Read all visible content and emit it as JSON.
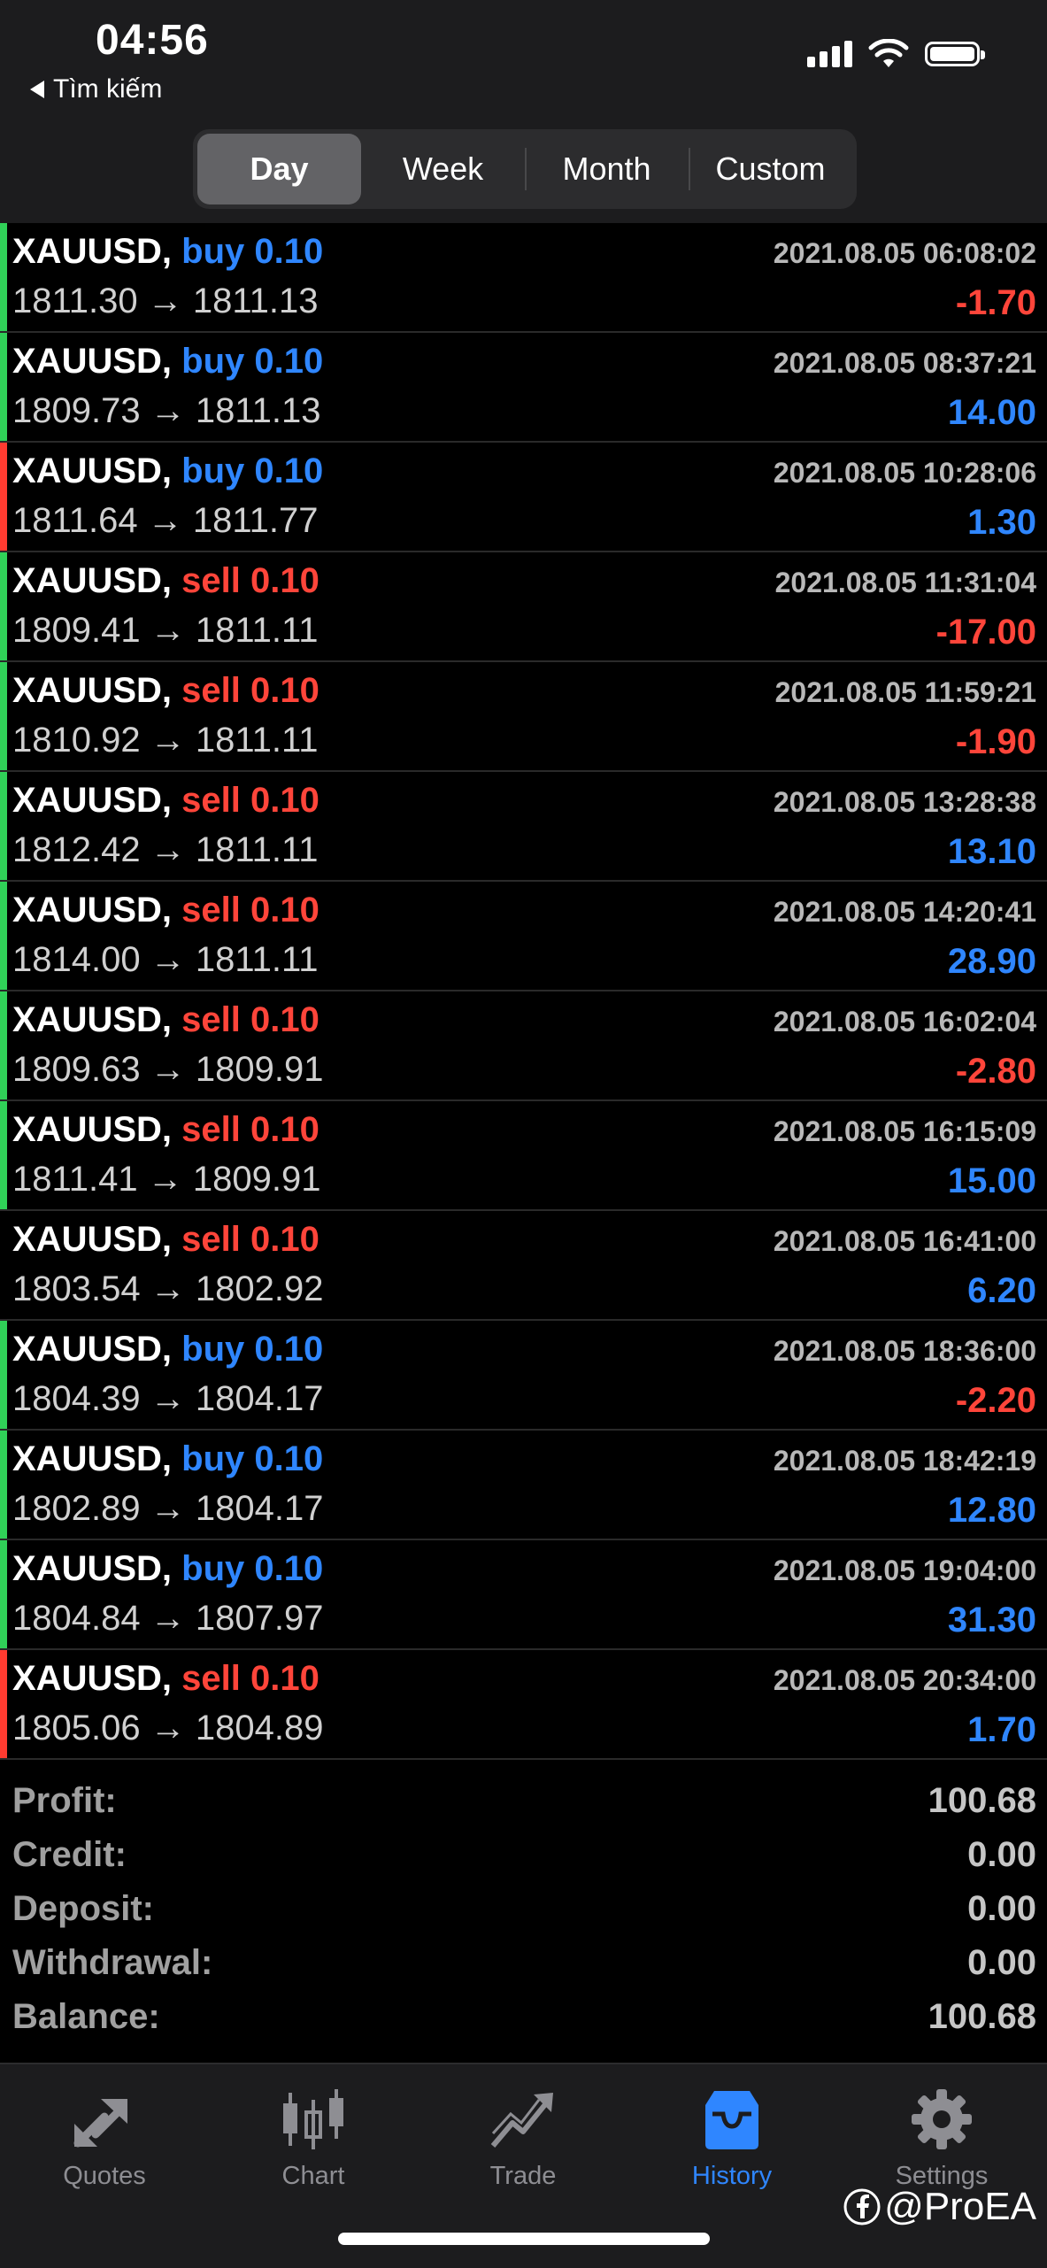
{
  "status_bar": {
    "time": "04:56",
    "back_label": "Tìm kiếm"
  },
  "period_tabs": [
    "Day",
    "Week",
    "Month",
    "Custom"
  ],
  "active_period": "Day",
  "deals": [
    {
      "symbol": "XAUUSD,",
      "side": "buy",
      "volume": "0.10",
      "time": "2021.08.05 06:08:02",
      "open": "1811.30",
      "arrow": "→",
      "close": "1811.13",
      "profit": "-1.70",
      "bar": "green"
    },
    {
      "symbol": "XAUUSD,",
      "side": "buy",
      "volume": "0.10",
      "time": "2021.08.05 08:37:21",
      "open": "1809.73",
      "arrow": "→",
      "close": "1811.13",
      "profit": "14.00",
      "bar": "green"
    },
    {
      "symbol": "XAUUSD,",
      "side": "buy",
      "volume": "0.10",
      "time": "2021.08.05 10:28:06",
      "open": "1811.64",
      "arrow": "→",
      "close": "1811.77",
      "profit": "1.30",
      "bar": "red"
    },
    {
      "symbol": "XAUUSD,",
      "side": "sell",
      "volume": "0.10",
      "time": "2021.08.05 11:31:04",
      "open": "1809.41",
      "arrow": "→",
      "close": "1811.11",
      "profit": "-17.00",
      "bar": "green"
    },
    {
      "symbol": "XAUUSD,",
      "side": "sell",
      "volume": "0.10",
      "time": "2021.08.05 11:59:21",
      "open": "1810.92",
      "arrow": "→",
      "close": "1811.11",
      "profit": "-1.90",
      "bar": "green"
    },
    {
      "symbol": "XAUUSD,",
      "side": "sell",
      "volume": "0.10",
      "time": "2021.08.05 13:28:38",
      "open": "1812.42",
      "arrow": "→",
      "close": "1811.11",
      "profit": "13.10",
      "bar": "green"
    },
    {
      "symbol": "XAUUSD,",
      "side": "sell",
      "volume": "0.10",
      "time": "2021.08.05 14:20:41",
      "open": "1814.00",
      "arrow": "→",
      "close": "1811.11",
      "profit": "28.90",
      "bar": "green"
    },
    {
      "symbol": "XAUUSD,",
      "side": "sell",
      "volume": "0.10",
      "time": "2021.08.05 16:02:04",
      "open": "1809.63",
      "arrow": "→",
      "close": "1809.91",
      "profit": "-2.80",
      "bar": "green"
    },
    {
      "symbol": "XAUUSD,",
      "side": "sell",
      "volume": "0.10",
      "time": "2021.08.05 16:15:09",
      "open": "1811.41",
      "arrow": "→",
      "close": "1809.91",
      "profit": "15.00",
      "bar": "green"
    },
    {
      "symbol": "XAUUSD,",
      "side": "sell",
      "volume": "0.10",
      "time": "2021.08.05 16:41:00",
      "open": "1803.54",
      "arrow": "→",
      "close": "1802.92",
      "profit": "6.20",
      "bar": "none"
    },
    {
      "symbol": "XAUUSD,",
      "side": "buy",
      "volume": "0.10",
      "time": "2021.08.05 18:36:00",
      "open": "1804.39",
      "arrow": "→",
      "close": "1804.17",
      "profit": "-2.20",
      "bar": "green"
    },
    {
      "symbol": "XAUUSD,",
      "side": "buy",
      "volume": "0.10",
      "time": "2021.08.05 18:42:19",
      "open": "1802.89",
      "arrow": "→",
      "close": "1804.17",
      "profit": "12.80",
      "bar": "green"
    },
    {
      "symbol": "XAUUSD,",
      "side": "buy",
      "volume": "0.10",
      "time": "2021.08.05 19:04:00",
      "open": "1804.84",
      "arrow": "→",
      "close": "1807.97",
      "profit": "31.30",
      "bar": "green"
    },
    {
      "symbol": "XAUUSD,",
      "side": "sell",
      "volume": "0.10",
      "time": "2021.08.05 20:34:00",
      "open": "1805.06",
      "arrow": "→",
      "close": "1804.89",
      "profit": "1.70",
      "bar": "red"
    }
  ],
  "summary": [
    {
      "label": "Profit:",
      "value": "100.68"
    },
    {
      "label": "Credit:",
      "value": "0.00"
    },
    {
      "label": "Deposit:",
      "value": "0.00"
    },
    {
      "label": "Withdrawal:",
      "value": "0.00"
    },
    {
      "label": "Balance:",
      "value": "100.68"
    }
  ],
  "tabbar": [
    {
      "label": "Quotes",
      "icon": "quotes-icon"
    },
    {
      "label": "Chart",
      "icon": "candlestick-icon"
    },
    {
      "label": "Trade",
      "icon": "trade-icon"
    },
    {
      "label": "History",
      "icon": "history-icon"
    },
    {
      "label": "Settings",
      "icon": "gear-icon"
    }
  ],
  "active_tab": "History",
  "watermark": "@ProEA",
  "colors": {
    "buy": "#2f86ff",
    "sell": "#ff453a",
    "bar_green": "#30d158",
    "bar_red": "#ff3b30",
    "accent": "#2f86ff",
    "header_bg": "#1c1c1e"
  }
}
